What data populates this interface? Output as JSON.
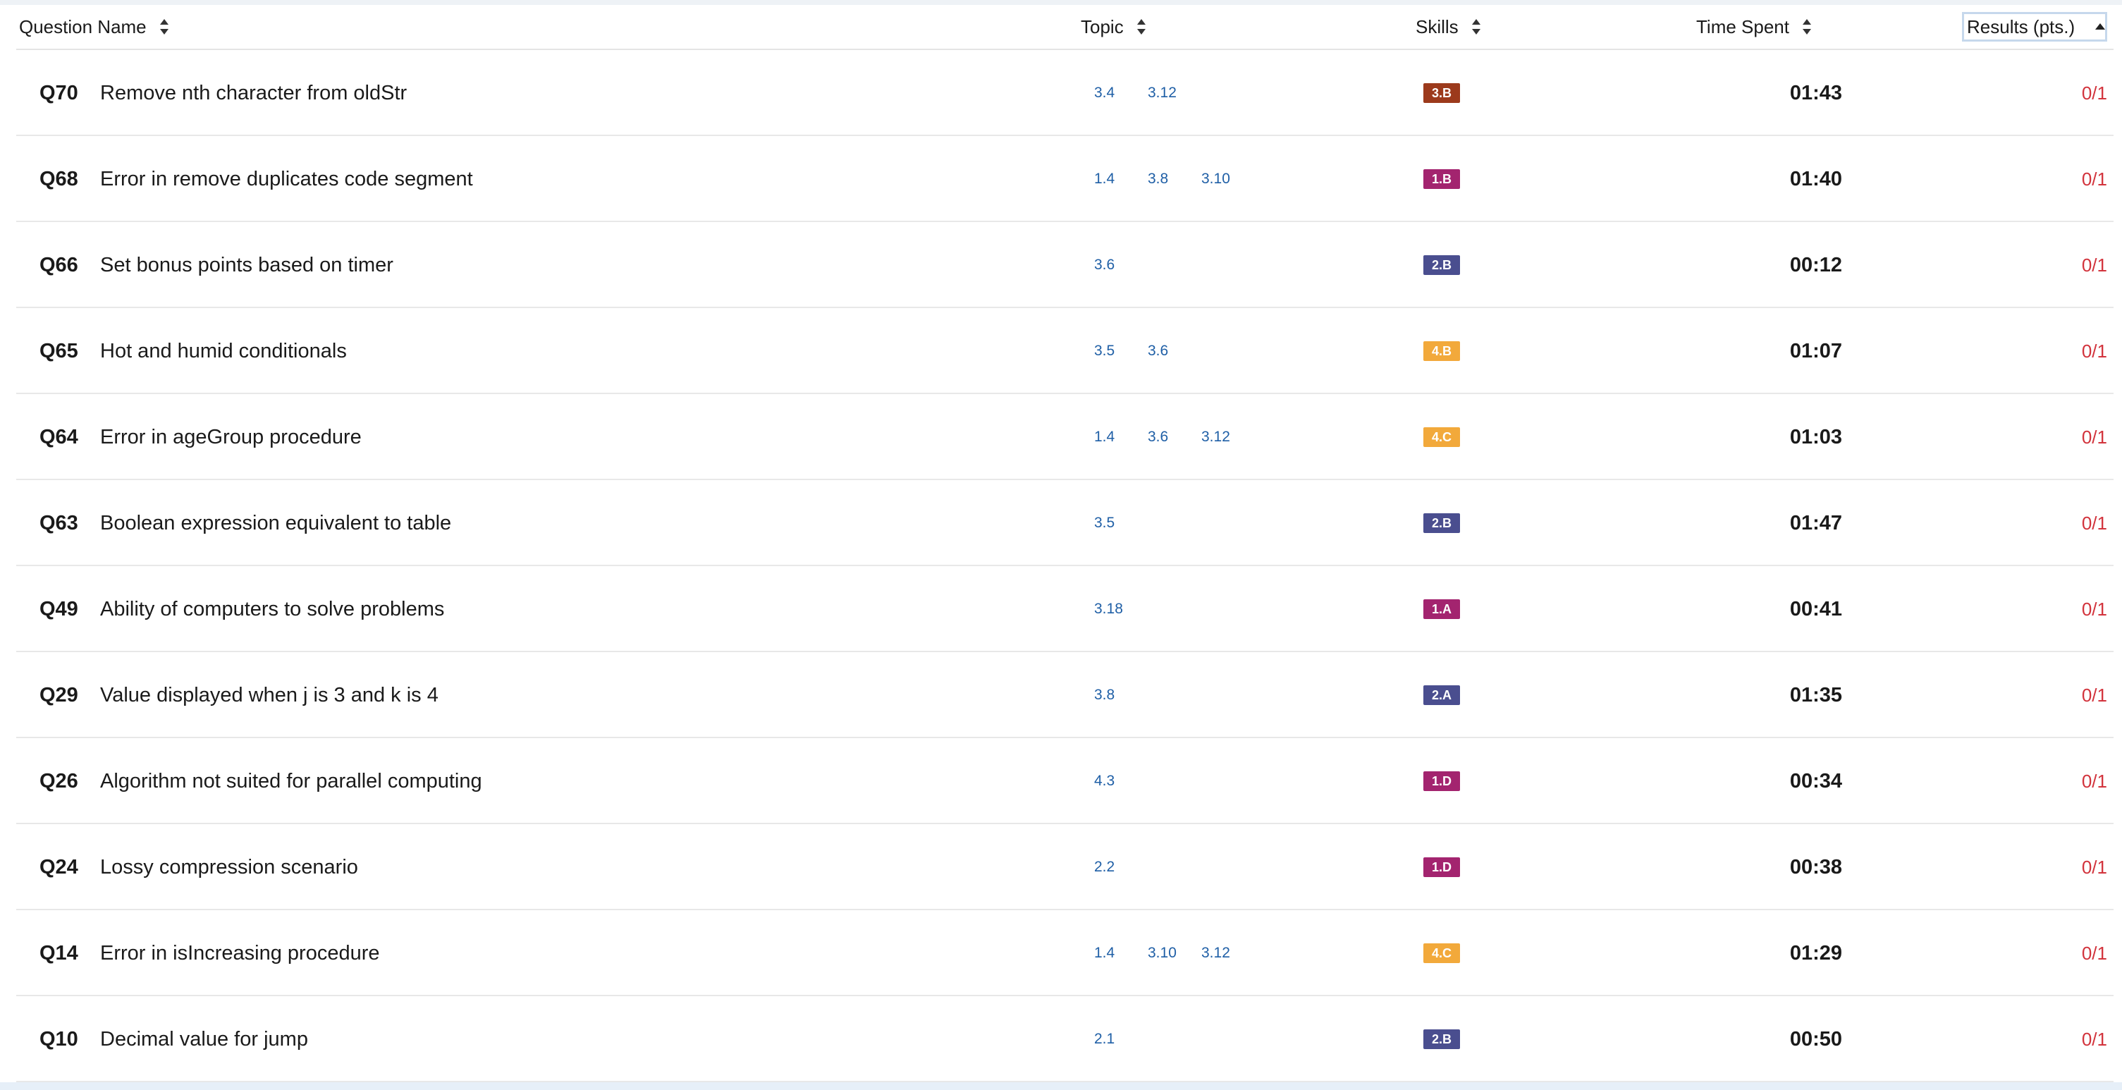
{
  "colors": {
    "topic_link": "#1f5fa6",
    "result_text": "#d2333c",
    "skill_3B": "#9c3a1c",
    "skill_1x": "#a3246f",
    "skill_2x": "#4a4e8f",
    "skill_4x": "#f2a93b"
  },
  "header": {
    "question_name": "Question Name",
    "topic": "Topic",
    "skills": "Skills",
    "time_spent": "Time Spent",
    "results": "Results (pts.)"
  },
  "rows": [
    {
      "id": "Q70",
      "name": "Remove nth character from oldStr",
      "topics": [
        "3.4",
        "3.12",
        ""
      ],
      "skill": "3.B",
      "skill_color": "#9c3a1c",
      "time": "01:43",
      "result": "0/1"
    },
    {
      "id": "Q68",
      "name": "Error in remove duplicates code segment",
      "topics": [
        "1.4",
        "3.8",
        "3.10"
      ],
      "skill": "1.B",
      "skill_color": "#a3246f",
      "time": "01:40",
      "result": "0/1"
    },
    {
      "id": "Q66",
      "name": "Set bonus points based on timer",
      "topics": [
        "3.6",
        "",
        ""
      ],
      "skill": "2.B",
      "skill_color": "#4a4e8f",
      "time": "00:12",
      "result": "0/1"
    },
    {
      "id": "Q65",
      "name": "Hot and humid conditionals",
      "topics": [
        "3.5",
        "3.6",
        ""
      ],
      "skill": "4.B",
      "skill_color": "#f2a93b",
      "time": "01:07",
      "result": "0/1"
    },
    {
      "id": "Q64",
      "name": "Error in ageGroup procedure",
      "topics": [
        "1.4",
        "3.6",
        "3.12"
      ],
      "skill": "4.C",
      "skill_color": "#f2a93b",
      "time": "01:03",
      "result": "0/1"
    },
    {
      "id": "Q63",
      "name": "Boolean expression equivalent to table",
      "topics": [
        "3.5",
        "",
        ""
      ],
      "skill": "2.B",
      "skill_color": "#4a4e8f",
      "time": "01:47",
      "result": "0/1"
    },
    {
      "id": "Q49",
      "name": "Ability of computers to solve problems",
      "topics": [
        "3.18",
        "",
        ""
      ],
      "skill": "1.A",
      "skill_color": "#a3246f",
      "time": "00:41",
      "result": "0/1"
    },
    {
      "id": "Q29",
      "name": "Value displayed when j is 3 and k is 4",
      "topics": [
        "3.8",
        "",
        ""
      ],
      "skill": "2.A",
      "skill_color": "#4a4e8f",
      "time": "01:35",
      "result": "0/1"
    },
    {
      "id": "Q26",
      "name": "Algorithm not suited for parallel computing",
      "topics": [
        "4.3",
        "",
        ""
      ],
      "skill": "1.D",
      "skill_color": "#a3246f",
      "time": "00:34",
      "result": "0/1"
    },
    {
      "id": "Q24",
      "name": "Lossy compression scenario",
      "topics": [
        "2.2",
        "",
        ""
      ],
      "skill": "1.D",
      "skill_color": "#a3246f",
      "time": "00:38",
      "result": "0/1"
    },
    {
      "id": "Q14",
      "name": "Error in isIncreasing procedure",
      "topics": [
        "1.4",
        "3.10",
        "3.12"
      ],
      "skill": "4.C",
      "skill_color": "#f2a93b",
      "time": "01:29",
      "result": "0/1"
    },
    {
      "id": "Q10",
      "name": "Decimal value for jump",
      "topics": [
        "2.1",
        "",
        ""
      ],
      "skill": "2.B",
      "skill_color": "#4a4e8f",
      "time": "00:50",
      "result": "0/1"
    }
  ]
}
